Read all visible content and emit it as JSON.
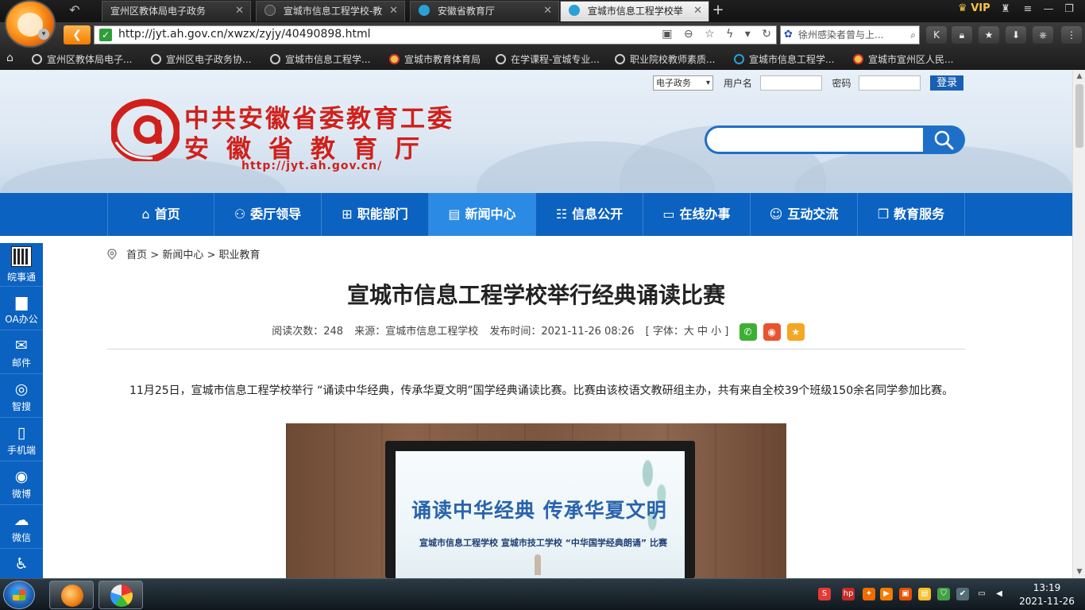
{
  "browser": {
    "tabs": [
      {
        "title": "宣州区教体局电子政务",
        "active": false
      },
      {
        "title": "宣城市信息工程学校-教",
        "active": false
      },
      {
        "title": "安徽省教育厅",
        "active": false
      },
      {
        "title": "宣城市信息工程学校举",
        "active": true
      }
    ],
    "vip_label": "VIP",
    "url": "http://jyt.ah.gov.cn/xwzx/zyjy/40490898.html",
    "search_text": "徐州感染者曾与上...",
    "bookmarks": [
      "宣州区教体局电子...",
      "宣州区电子政务协...",
      "宣城市信息工程学...",
      "宣城市教育体育局",
      "在学课程-宣城专业...",
      "职业院校教师素质...",
      "宣城市信息工程学...",
      "宣城市宣州区人民..."
    ]
  },
  "header": {
    "login": {
      "select_value": "电子政务",
      "username_label": "用户名",
      "password_label": "密码",
      "login_button": "登录"
    },
    "logo_title_1": "中共安徽省委教育工委",
    "logo_title_2": "安徽省教育厅",
    "logo_url": "http://jyt.ah.gov.cn/"
  },
  "nav": {
    "items": [
      {
        "label": "首页",
        "icon": "home-icon",
        "active": false
      },
      {
        "label": "委厅领导",
        "icon": "people-icon",
        "active": false
      },
      {
        "label": "职能部门",
        "icon": "org-chart-icon",
        "active": false
      },
      {
        "label": "新闻中心",
        "icon": "news-icon",
        "active": true
      },
      {
        "label": "信息公开",
        "icon": "document-icon",
        "active": false
      },
      {
        "label": "在线办事",
        "icon": "monitor-icon",
        "active": false
      },
      {
        "label": "互动交流",
        "icon": "chat-icon",
        "active": false
      },
      {
        "label": "教育服务",
        "icon": "book-icon",
        "active": false
      }
    ]
  },
  "sidebar": {
    "items": [
      {
        "label": "皖事通",
        "icon": "qr-code-icon"
      },
      {
        "label": "OA办公",
        "icon": "briefcase-icon"
      },
      {
        "label": "邮件",
        "icon": "mail-icon"
      },
      {
        "label": "智搜",
        "icon": "smart-search-icon"
      },
      {
        "label": "手机端",
        "icon": "mobile-icon"
      },
      {
        "label": "微博",
        "icon": "weibo-icon"
      },
      {
        "label": "微信",
        "icon": "wechat-icon"
      },
      {
        "label": "",
        "icon": "accessibility-icon"
      }
    ]
  },
  "breadcrumb": {
    "home": "首页",
    "sep": ">",
    "level1": "新闻中心",
    "level2": "职业教育"
  },
  "article": {
    "title": "宣城市信息工程学校举行经典诵读比赛",
    "reads_label": "阅读次数：",
    "reads": "248",
    "source_label": "来源：",
    "source": "宣城市信息工程学校",
    "date_label": "发布时间：",
    "date": "2021-11-26 08:26",
    "font_label": "[ 字体：大 中 小 ]",
    "paragraph": "11月25日，宣城市信息工程学校举行 “诵读中华经典，传承华夏文明”国学经典诵读比赛。比赛由该校语文教研组主办，共有来自全校39个班级150余名同学参加比赛。",
    "photo_headline": "诵读中华经典 传承华夏文明",
    "photo_subline": "宣城市信息工程学校  宣城市技工学校 “中华国学经典朗诵” 比赛"
  },
  "taskbar": {
    "time": "13:19",
    "date": "2021-11-26"
  }
}
